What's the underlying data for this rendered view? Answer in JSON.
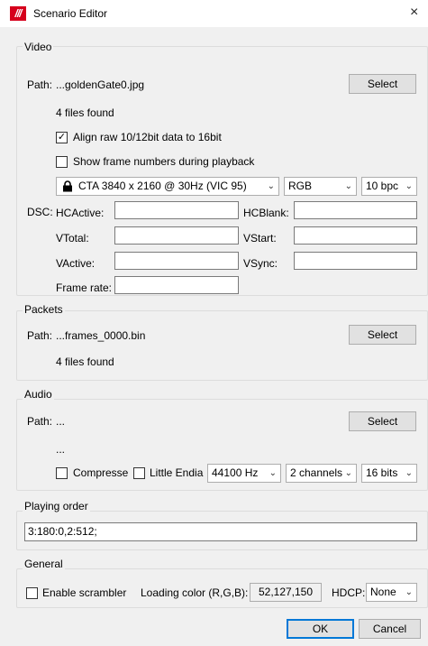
{
  "window": {
    "logo": "///",
    "title": "Scenario Editor",
    "close": "×"
  },
  "video": {
    "group_label": "Video",
    "path_label": "Path:",
    "path_value": "...goldenGate0.jpg",
    "select_label": "Select",
    "files_found": "4 files found",
    "align_label": "Align raw 10/12bit data to 16bit",
    "align_checked": true,
    "show_frames_label": "Show frame numbers during playback",
    "show_frames_checked": false,
    "timing": "CTA 3840 x 2160 @ 30Hz (VIC 95)",
    "color_format": "RGB",
    "bpc": "10 bpc",
    "dsc_label": "DSC:",
    "hcactive_label": "HCActive:",
    "hcblank_label": "HCBlank:",
    "vtotal_label": "VTotal:",
    "vstart_label": "VStart:",
    "vactive_label": "VActive:",
    "vsync_label": "VSync:",
    "framerate_label": "Frame rate:"
  },
  "packets": {
    "group_label": "Packets",
    "path_label": "Path:",
    "path_value": "...frames_0000.bin",
    "select_label": "Select",
    "files_found": "4 files found"
  },
  "audio": {
    "group_label": "Audio",
    "path_label": "Path:",
    "path_value": "...",
    "select_label": "Select",
    "status": "...",
    "compress_label": "Compresse",
    "compress_checked": false,
    "little_endian_label": "Little Endia",
    "little_endian_checked": false,
    "sample_rate": "44100 Hz",
    "channels": "2 channels",
    "bits": "16 bits"
  },
  "playing_order": {
    "group_label": "Playing order",
    "value": "3:180:0,2:512;"
  },
  "general": {
    "group_label": "General",
    "scrambler_label": "Enable scrambler",
    "scrambler_checked": false,
    "loading_color_label": "Loading color (R,G,B):",
    "loading_color_value": "52,127,150",
    "hdcp_label": "HDCP:",
    "hdcp_value": "None"
  },
  "footer": {
    "ok_label": "OK",
    "cancel_label": "Cancel"
  },
  "icons": {
    "combo_arrow": "⌄",
    "checkmark": "✓"
  }
}
